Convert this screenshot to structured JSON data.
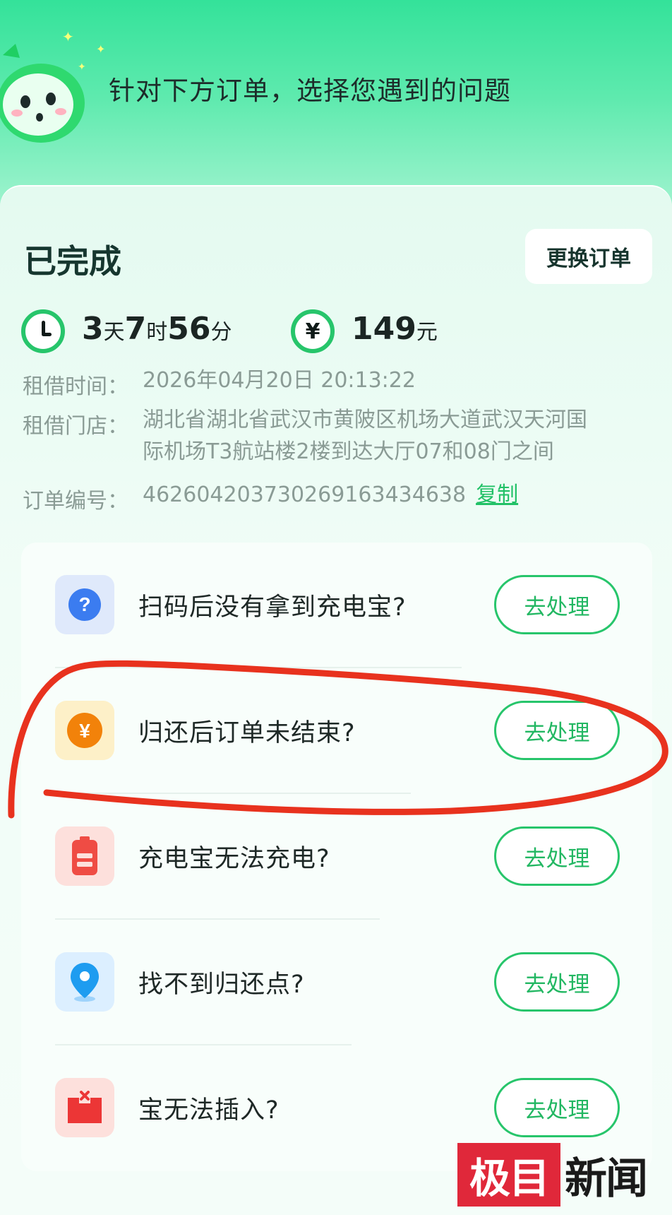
{
  "header": {
    "title": "针对下方订单，选择您遇到的问题"
  },
  "order": {
    "status": "已完成",
    "change_button": "更换订单",
    "duration": {
      "days": "3",
      "days_unit": "天",
      "hours": "7",
      "hours_unit": "时",
      "minutes": "56",
      "minutes_unit": "分"
    },
    "price": {
      "amount": "149",
      "unit": "元",
      "icon_glyph": "¥"
    },
    "rent_time_label": "租借时间：",
    "rent_time": "2026年04月20日 20:13:22",
    "store_label": "租借门店：",
    "store_line1": "湖北省湖北省武汉市黄陂区机场大道武汉天河国",
    "store_line2": "际机场T3航站楼2楼到达大厅07和08门之间",
    "order_no_label": "订单编号：",
    "order_no": "462604203730269163434638",
    "copy_label": "复制"
  },
  "issues": [
    {
      "text": "扫码后没有拿到充电宝?",
      "button": "去处理",
      "icon": "question-icon",
      "color": "#3b7cf0"
    },
    {
      "text": "归还后订单未结束?",
      "button": "去处理",
      "icon": "yen-coin-icon",
      "color": "#f2820a"
    },
    {
      "text": "充电宝无法充电?",
      "button": "去处理",
      "icon": "battery-icon",
      "color": "#ef4c44"
    },
    {
      "text": "找不到归还点?",
      "button": "去处理",
      "icon": "location-pin-icon",
      "color": "#1e9cf0"
    },
    {
      "text": "宝无法插入?",
      "button": "去处理",
      "icon": "slot-error-icon",
      "color": "#ec3636"
    }
  ],
  "watermark": {
    "box_text": "极目",
    "text": "新闻"
  },
  "colors": {
    "accent_green": "#27c56b",
    "annotation_red": "#e8321e"
  }
}
